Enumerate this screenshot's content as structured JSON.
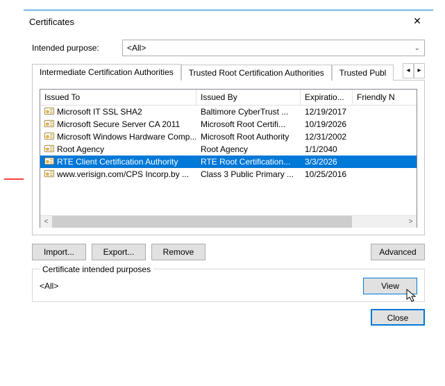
{
  "dialog": {
    "title": "Certificates",
    "purpose_label": "Intended purpose:",
    "purpose_value": "<All>"
  },
  "tabs": {
    "t0": "Intermediate Certification Authorities",
    "t1": "Trusted Root Certification Authorities",
    "t2": "Trusted Publ"
  },
  "columns": {
    "c0": "Issued To",
    "c1": "Issued By",
    "c2": "Expiratio...",
    "c3": "Friendly N"
  },
  "rows": [
    {
      "issued_to": "Microsoft IT SSL SHA2",
      "issued_by": "Baltimore CyberTrust ...",
      "expir": "12/19/2017",
      "friendly": "<None>",
      "selected": false
    },
    {
      "issued_to": "Microsoft Secure Server CA 2011",
      "issued_by": "Microsoft Root Certifi...",
      "expir": "10/19/2026",
      "friendly": "<None>",
      "selected": false
    },
    {
      "issued_to": "Microsoft Windows Hardware Comp...",
      "issued_by": "Microsoft Root Authority",
      "expir": "12/31/2002",
      "friendly": "<None>",
      "selected": false
    },
    {
      "issued_to": "Root Agency",
      "issued_by": "Root Agency",
      "expir": "1/1/2040",
      "friendly": "<None>",
      "selected": false
    },
    {
      "issued_to": "RTE Client Certification Authority",
      "issued_by": "RTE Root Certification...",
      "expir": "3/3/2026",
      "friendly": "<None>",
      "selected": true
    },
    {
      "issued_to": "www.verisign.com/CPS Incorp.by ...",
      "issued_by": "Class 3 Public Primary ...",
      "expir": "10/25/2016",
      "friendly": "<None>",
      "selected": false
    }
  ],
  "buttons": {
    "import": "Import...",
    "export": "Export...",
    "remove": "Remove",
    "advanced": "Advanced",
    "view": "View",
    "close": "Close"
  },
  "group": {
    "title": "Certificate intended purposes",
    "value": "<All>"
  },
  "annotations": {
    "arrow1_target": "intended-purpose-dropdown",
    "arrow2_target": "selected-certificate-row"
  }
}
